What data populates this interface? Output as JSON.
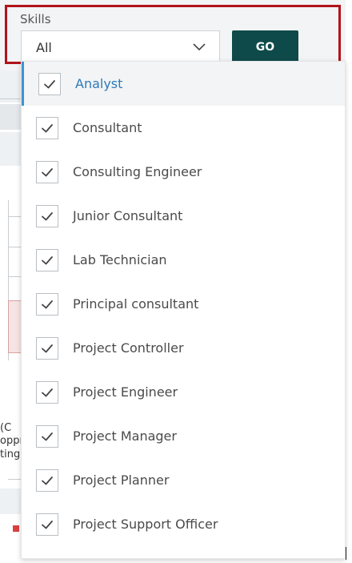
{
  "filter": {
    "label": "Skills",
    "selected": "All",
    "go_label": "GO"
  },
  "options": [
    {
      "label": "Analyst",
      "checked": true,
      "highlighted": true
    },
    {
      "label": "Consultant",
      "checked": true
    },
    {
      "label": "Consulting Engineer",
      "checked": true
    },
    {
      "label": "Junior Consultant",
      "checked": true
    },
    {
      "label": "Lab Technician",
      "checked": true
    },
    {
      "label": "Principal consultant",
      "checked": true
    },
    {
      "label": "Project Controller",
      "checked": true
    },
    {
      "label": "Project Engineer",
      "checked": true
    },
    {
      "label": "Project Manager",
      "checked": true
    },
    {
      "label": "Project Planner",
      "checked": true
    },
    {
      "label": "Project Support Officer",
      "checked": true
    }
  ],
  "background_fragments": [
    "(C",
    "oppr",
    "ting"
  ],
  "colors": {
    "highlight_border": "#b2121b",
    "go_button": "#0f4a4a",
    "selected_text": "#2f7ab8",
    "selected_accent": "#3a94d4"
  }
}
